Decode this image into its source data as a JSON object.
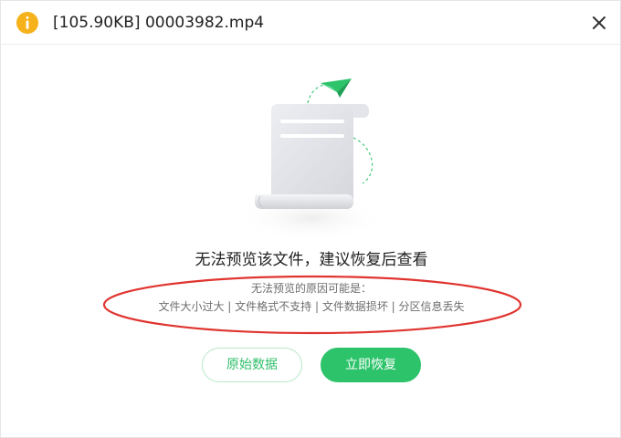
{
  "window": {
    "title": "[105.90KB] 00003982.mp4",
    "accent_color": "#2cc36a",
    "info_icon_color": "#f6b21b",
    "annotation_color": "#e0342f"
  },
  "icons": {
    "info": "info-icon",
    "close": "close-icon",
    "illustration": "document-scroll-with-paper-plane"
  },
  "main": {
    "headline": "无法预览该文件，建议恢复后查看",
    "reason_title": "无法预览的原因可能是：",
    "reasons": "文件大小过大 | 文件格式不支持 | 文件数据损坏 | 分区信息丢失"
  },
  "buttons": {
    "raw_data": "原始数据",
    "recover_now": "立即恢复"
  }
}
